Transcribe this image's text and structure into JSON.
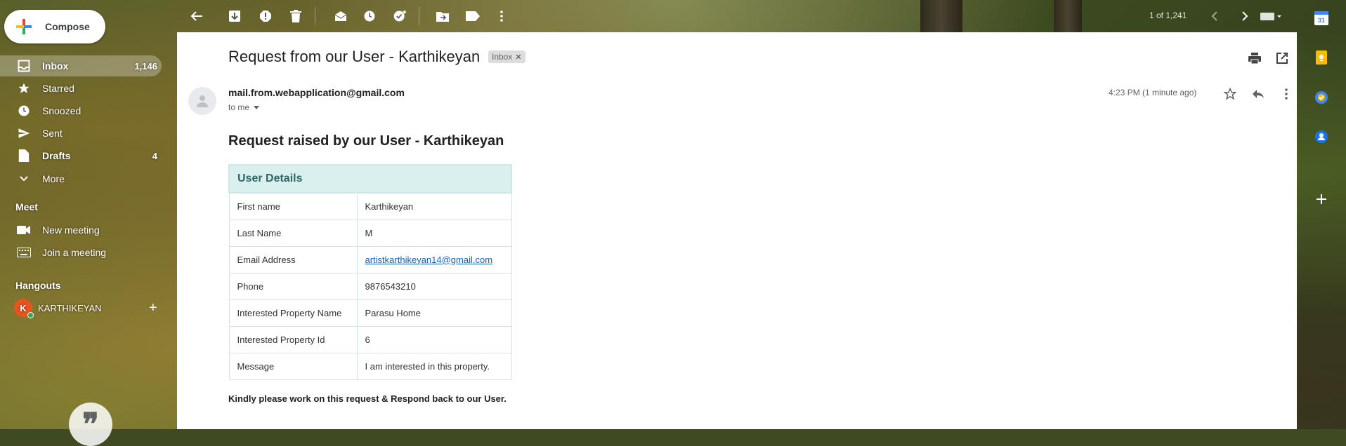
{
  "compose": {
    "label": "Compose"
  },
  "nav": {
    "items": [
      {
        "label": "Inbox",
        "count": "1,146",
        "icon": "inbox-icon"
      },
      {
        "label": "Starred",
        "count": "",
        "icon": "star-icon"
      },
      {
        "label": "Snoozed",
        "count": "",
        "icon": "clock-icon"
      },
      {
        "label": "Sent",
        "count": "",
        "icon": "send-icon"
      },
      {
        "label": "Drafts",
        "count": "4",
        "icon": "draft-icon"
      },
      {
        "label": "More",
        "count": "",
        "icon": "chevron-down-icon"
      }
    ]
  },
  "meet": {
    "title": "Meet",
    "new_meeting": "New meeting",
    "join_meeting": "Join a meeting"
  },
  "hangouts": {
    "title": "Hangouts",
    "user_initial": "K",
    "user_name": "KARTHIKEYAN"
  },
  "toolbar": {
    "count": "1 of 1,241"
  },
  "message": {
    "subject": "Request from our User - Karthikeyan",
    "label": "Inbox",
    "sender": "mail.from.webapplication@gmail.com",
    "to": "to me",
    "timestamp": "4:23 PM (1 minute ago)",
    "heading": "Request raised by our User - Karthikeyan",
    "table_title": "User Details",
    "rows": [
      {
        "field": "First name",
        "value": "Karthikeyan"
      },
      {
        "field": "Last Name",
        "value": "M"
      },
      {
        "field": "Email Address",
        "value": "artistkarthikeyan14@gmail.com"
      },
      {
        "field": "Phone",
        "value": "9876543210"
      },
      {
        "field": "Interested Property Name",
        "value": "Parasu Home"
      },
      {
        "field": "Interested Property Id",
        "value": "6"
      },
      {
        "field": "Message",
        "value": "I am interested in this property."
      }
    ],
    "footer": "Kindly please work on this request & Respond back to our User."
  },
  "rail": {
    "calendar_day": "31"
  },
  "colors": {
    "accent_blue": "#1a73e8",
    "table_header_bg": "#daf0ee",
    "table_header_text": "#2d6a66",
    "avatar_orange": "#e8541f"
  }
}
